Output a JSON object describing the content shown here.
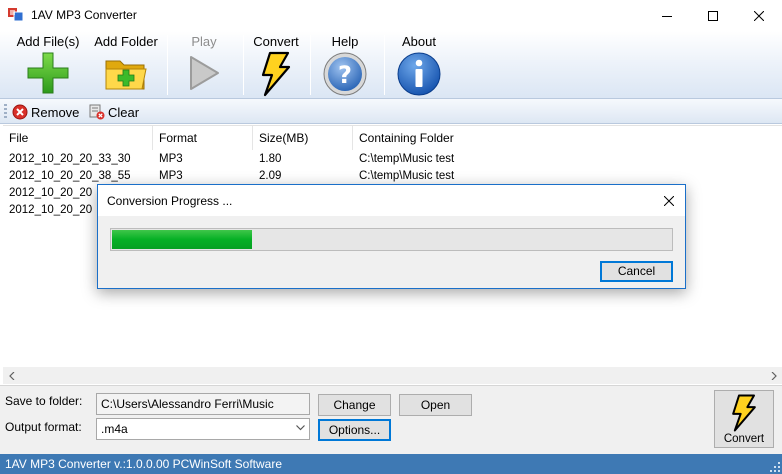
{
  "window": {
    "title": "1AV MP3 Converter"
  },
  "toolbar": {
    "items": [
      {
        "label": "Add File(s)",
        "icon": "plus-icon",
        "enabled": true
      },
      {
        "label": "Add Folder",
        "icon": "folder-add-icon",
        "enabled": true
      },
      {
        "label": "Play",
        "icon": "play-icon",
        "enabled": false
      },
      {
        "label": "Convert",
        "icon": "lightning-icon",
        "enabled": true
      },
      {
        "label": "Help",
        "icon": "question-icon",
        "enabled": true
      },
      {
        "label": "About",
        "icon": "info-icon",
        "enabled": true
      }
    ]
  },
  "subtoolbar": {
    "remove_label": "Remove",
    "clear_label": "Clear"
  },
  "file_list": {
    "columns": [
      "File",
      "Format",
      "Size(MB)",
      "Containing Folder"
    ],
    "rows": [
      {
        "file": "2012_10_20_20_33_30",
        "format": "MP3",
        "size": "1.80",
        "folder": "C:\\temp\\Music test"
      },
      {
        "file": "2012_10_20_20_38_55",
        "format": "MP3",
        "size": "2.09",
        "folder": "C:\\temp\\Music test"
      },
      {
        "file": "2012_10_20_20",
        "format": "",
        "size": "",
        "folder": ""
      },
      {
        "file": "2012_10_20_20",
        "format": "",
        "size": "",
        "folder": ""
      }
    ]
  },
  "bottom": {
    "save_to_label": "Save to folder:",
    "save_to_value": "C:\\Users\\Alessandro Ferri\\Music",
    "change_label": "Change",
    "open_label": "Open",
    "output_format_label": "Output format:",
    "output_format_value": ".m4a",
    "options_label": "Options...",
    "convert_label": "Convert"
  },
  "status": {
    "text": "1AV MP3 Converter v.:1.0.0.00 PCWinSoft Software"
  },
  "dialog": {
    "title": "Conversion Progress ...",
    "progress_fraction": 0.25,
    "cancel_label": "Cancel"
  },
  "colors": {
    "status_bar": "#3e79b4",
    "progress_fill": "#06b025",
    "dialog_border": "#1a6fc9"
  }
}
